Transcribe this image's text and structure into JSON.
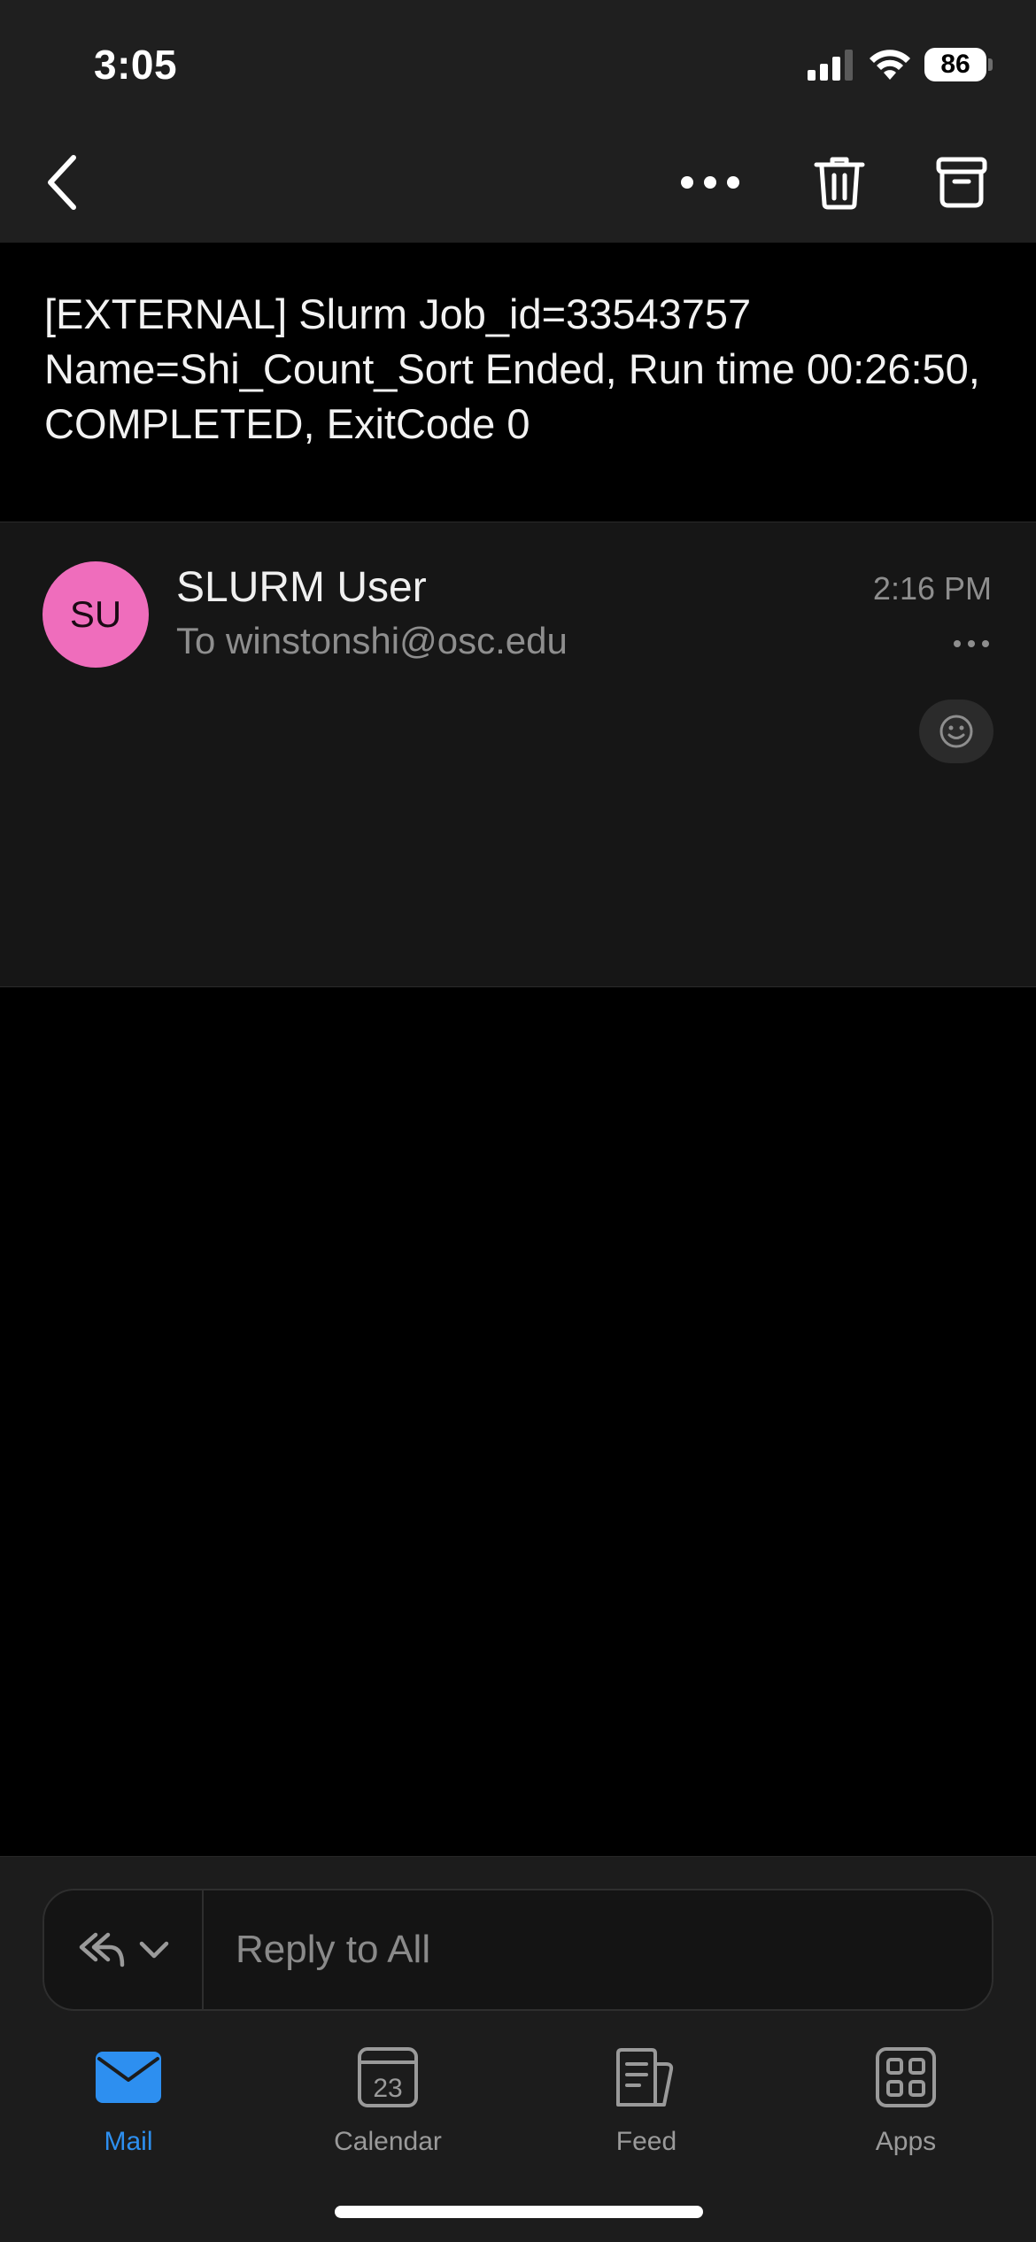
{
  "status_bar": {
    "time": "3:05",
    "battery": "86"
  },
  "nav": {
    "back_icon": "chevron-left-icon",
    "more_icon": "ellipsis-icon",
    "delete_icon": "trash-icon",
    "archive_icon": "archive-icon"
  },
  "email": {
    "subject": "[EXTERNAL] Slurm Job_id=33543757 Name=Shi_Count_Sort Ended, Run time 00:26:50, COMPLETED, ExitCode 0",
    "sender_initials": "SU",
    "sender_name": "SLURM User",
    "recipient": "To winstonshi@osc.edu",
    "time": "2:16 PM",
    "avatar_color": "#ef6dbc"
  },
  "reply": {
    "placeholder": "Reply to All"
  },
  "tabs": [
    {
      "label": "Mail",
      "icon": "mail-icon",
      "active": true
    },
    {
      "label": "Calendar",
      "icon": "calendar-icon",
      "badge": "23"
    },
    {
      "label": "Feed",
      "icon": "feed-icon"
    },
    {
      "label": "Apps",
      "icon": "apps-icon"
    }
  ],
  "colors": {
    "accent": "#2d8ff0",
    "background": "#000000",
    "surface": "#1f1f1f"
  }
}
